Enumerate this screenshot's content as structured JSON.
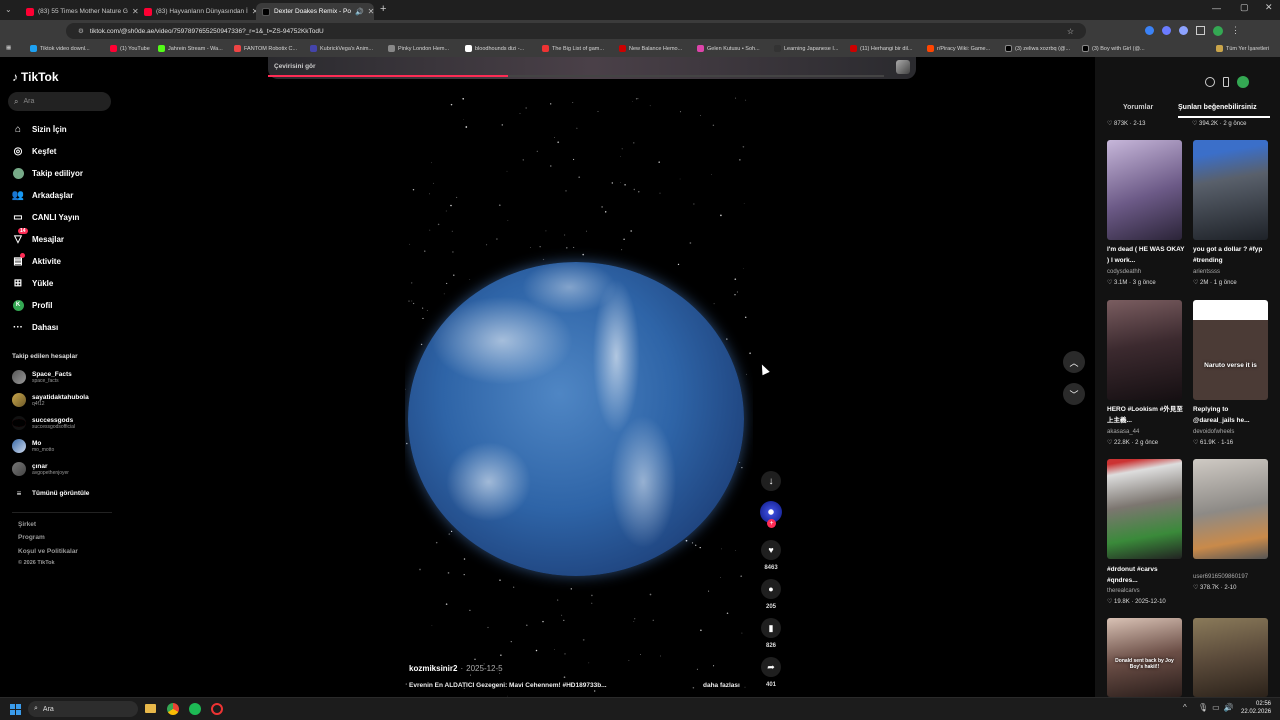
{
  "browser": {
    "tabs": [
      {
        "title": "(83) 55 Times Mother Nature G",
        "color": "#ff0033"
      },
      {
        "title": "(83) Hayvanların Dünyasından İ",
        "color": "#ff0033"
      },
      {
        "title": "Dexter Doakes Remix - Po",
        "color": "#ffffff"
      }
    ],
    "url": "tiktok.com/@sh0de.ae/video/7597897655250947336?_r=1&_t=ZS-94752KkTodU",
    "bookmarks": [
      "Tiktok video downl...",
      "(1) YouTube",
      "Jahrein Stream - Wa...",
      "FANTOM Robotix C...",
      "KubrickVega's Anim...",
      "Pinky London Hem...",
      "bloodhounds dizi -...",
      "The Big List of gam...",
      "New Balance Hemo...",
      "Gelen Kutusu • Soh...",
      "Learning Japanese I...",
      "(11) Herhangi bir dil...",
      "r/Piracy Wiki: Game...",
      "(3) zeliwa xozrbq (@...",
      "(3) Boy with Girl (@..."
    ],
    "bookmarks_folder": "Tüm Yer İşaretleri"
  },
  "sidebar": {
    "logo": "TikTok",
    "search_placeholder": "Ara",
    "nav": [
      {
        "label": "Sizin İçin",
        "icon": "home-icon"
      },
      {
        "label": "Keşfet",
        "icon": "compass-icon"
      },
      {
        "label": "Takip ediliyor",
        "icon": "following-avatar-icon"
      },
      {
        "label": "Arkadaşlar",
        "icon": "friends-icon"
      },
      {
        "label": "CANLI Yayın",
        "icon": "live-icon"
      },
      {
        "label": "Mesajlar",
        "icon": "messages-icon",
        "badge": "14"
      },
      {
        "label": "Aktivite",
        "icon": "activity-icon"
      },
      {
        "label": "Yükle",
        "icon": "upload-icon"
      },
      {
        "label": "Profil",
        "icon": "profile-icon",
        "avatar_letter": "K"
      },
      {
        "label": "Dahası",
        "icon": "more-icon"
      }
    ],
    "following_title": "Takip edilen hesaplar",
    "following": [
      {
        "name": "Space_Facts",
        "handle": "space_facts"
      },
      {
        "name": "sayatidaktahubola",
        "handle": "q4f12"
      },
      {
        "name": "successgods",
        "handle": "successgodsofficial"
      },
      {
        "name": "Mo",
        "handle": "mo_motto"
      },
      {
        "name": "çınar",
        "handle": "avgopethenjoyer"
      }
    ],
    "see_all": "Tümünü görüntüle",
    "footer": [
      "Şirket",
      "Program",
      "Koşul ve Politikalar",
      "© 2026 TikTok"
    ]
  },
  "video": {
    "translate_label": "Çevirisini gör",
    "author": "kozmiksinir2",
    "date": "2025-12-5",
    "description": "Evrenin En ALDATICI Gezegeni: Mavi Cehennem! #HD189733b...",
    "more": "daha fazlası",
    "likes": "8463",
    "comments": "205",
    "saves": "826",
    "shares": "401"
  },
  "rightpanel": {
    "tabs": [
      "Yorumlar",
      "Şunları beğenebilirsiniz"
    ],
    "top_stats": [
      {
        "likes": "873K",
        "date": "2-13"
      },
      {
        "likes": "394.2K",
        "date": "2 g önce"
      }
    ],
    "items": [
      {
        "caption": "I'm dead ( HE WAS OKAY ) I work...",
        "user": "codysdeathh",
        "likes": "3.1M",
        "date": "3 g önce",
        "color": "#6c5a87"
      },
      {
        "caption": "you got a dollar ? #fyp #trending",
        "user": "arientssss",
        "likes": "2M",
        "date": "1 g önce",
        "color": "#59606b"
      },
      {
        "caption": "HERO #Lookism #外見至上主義...",
        "user": "akasasa_44",
        "likes": "22.8K",
        "date": "2 g önce",
        "color": "#3c2a2f"
      },
      {
        "caption": "Replying to @dareal_jails he...",
        "user": "devoidofwheels",
        "likes": "61.9K",
        "date": "1-16",
        "overlay": "Naruto verse it is",
        "color": "#4b3b36"
      },
      {
        "caption": "#drdonut #carvs #qndres...",
        "user": "therealcarvs",
        "likes": "19.8K",
        "date": "2025-12-10",
        "color": "#7c7670"
      },
      {
        "caption": "",
        "user": "user6916509860197",
        "likes": "378.7K",
        "date": "2-10",
        "color": "#8d8a86"
      },
      {
        "caption": "",
        "user": "",
        "likes": "",
        "date": "",
        "overlay": "Donald sent back by Joy Boy's hakii!!",
        "color": "#6b4e46"
      },
      {
        "caption": "",
        "user": "",
        "likes": "",
        "date": "",
        "color": "#5a4a3a"
      }
    ]
  },
  "taskbar": {
    "search": "Ara",
    "time": "02:56",
    "date": "22.02.2026"
  }
}
